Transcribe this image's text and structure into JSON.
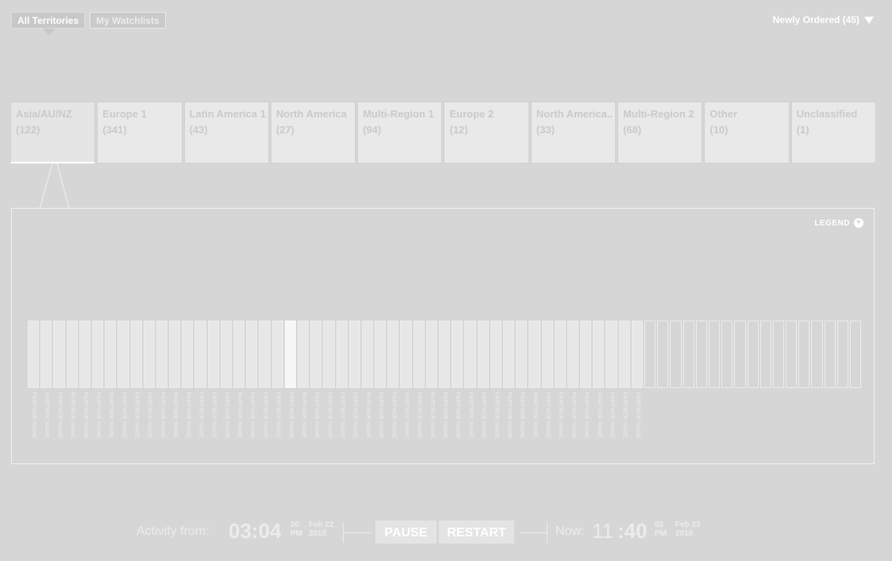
{
  "top_tabs": [
    {
      "label": "All Territories",
      "active": true
    },
    {
      "label": "My Watchlists",
      "active": false
    }
  ],
  "sort": {
    "label": "Newly Ordered (45)"
  },
  "territories": [
    {
      "name": "Asia/AU/NZ",
      "count": "(122)"
    },
    {
      "name": "Europe 1",
      "count": "(341)"
    },
    {
      "name": "Latin America 1",
      "count": "(43)"
    },
    {
      "name": "North America",
      "count": "(27)"
    },
    {
      "name": "Multi-Region 1",
      "count": "(94)"
    },
    {
      "name": "Europe 2",
      "count": "(12)"
    },
    {
      "name": "North America..",
      "count": "(33)"
    },
    {
      "name": "Multi-Region 2",
      "count": "(68)"
    },
    {
      "name": "Other",
      "count": "(10)"
    },
    {
      "name": "Unclassified",
      "count": "(1)"
    }
  ],
  "legend": {
    "label": "LEGEND"
  },
  "partners": {
    "filled_count": 48,
    "empty_count": 17,
    "highlight_index": 20,
    "label": "PARTNER NAME"
  },
  "activity": {
    "label": "Activity from:",
    "time": "03:04",
    "seconds": "20",
    "ampm": "PM",
    "date_day": "Feb 22",
    "date_year": "2010"
  },
  "buttons": {
    "pause": "PAUSE",
    "restart": "RESTART"
  },
  "now": {
    "label": "Now:",
    "hour": "11",
    "minute": ":40",
    "seconds": "02",
    "ampm": "PM",
    "date_day": "Feb 22",
    "date_year": "2010"
  },
  "colors": {
    "background": "#d6d6d6",
    "card": "#e9e9e9",
    "text": "#ffffff"
  }
}
